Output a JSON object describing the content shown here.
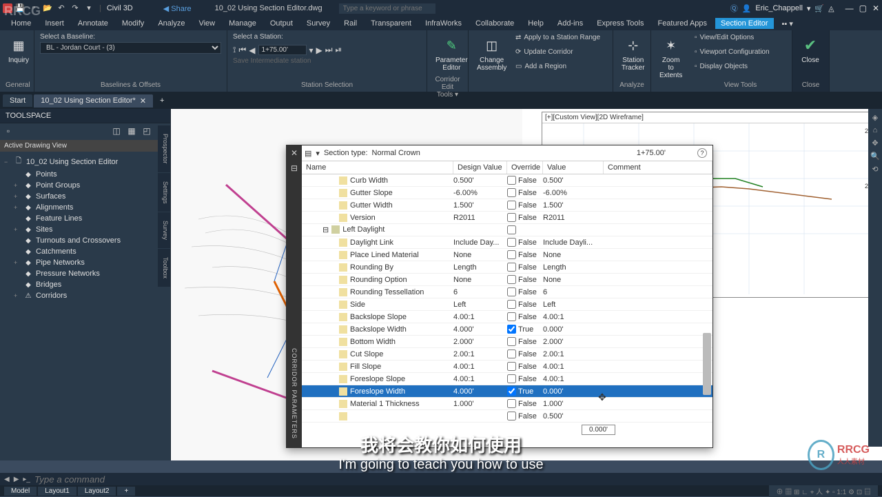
{
  "title": {
    "app": "Civil 3D",
    "share": "◀ Share",
    "filename": "10_02 Using Section Editor.dwg",
    "search_placeholder": "Type a keyword or phrase",
    "user": "Eric_Chappell"
  },
  "menus": [
    "Home",
    "Insert",
    "Annotate",
    "Modify",
    "Analyze",
    "View",
    "Manage",
    "Output",
    "Survey",
    "Rail",
    "Transparent",
    "InfraWorks",
    "Collaborate",
    "Help",
    "Add-ins",
    "Express Tools",
    "Featured Apps",
    "Section Editor"
  ],
  "ribbon": {
    "inquiry": "Inquiry",
    "baseline_label": "Select a Baseline:",
    "baseline_value": "BL - Jordan Court - (3)",
    "station_label": "Select a Station:",
    "station_value": "1+75.00'",
    "save_station": "Save Intermediate station",
    "panels": {
      "general": "General",
      "baselines": "Baselines & Offsets",
      "station": "Station Selection",
      "param_editor": "Parameter Editor",
      "change_asm": "Change Assembly",
      "apply_range": "Apply to a Station Range",
      "update_corr": "Update Corridor",
      "add_region": "Add a Region",
      "cet": "Corridor Edit Tools ▾",
      "st_tracker": "Station Tracker",
      "zoom_ext": "Zoom to Extents",
      "analyze": "Analyze",
      "veo": "View/Edit Options",
      "vpc": "Viewport Configuration",
      "disp": "Display Objects",
      "vt": "View Tools",
      "close": "Close"
    }
  },
  "tabs": {
    "start": "Start",
    "doc": "10_02 Using Section Editor*"
  },
  "toolspace": {
    "title": "TOOLSPACE",
    "adv": "Active Drawing View",
    "root": "10_02 Using Section Editor",
    "nodes": [
      {
        "label": "Points",
        "exp": ""
      },
      {
        "label": "Point Groups",
        "exp": "+"
      },
      {
        "label": "Surfaces",
        "exp": "+"
      },
      {
        "label": "Alignments",
        "exp": "+"
      },
      {
        "label": "Feature Lines",
        "exp": ""
      },
      {
        "label": "Sites",
        "exp": "+"
      },
      {
        "label": "Turnouts and Crossovers",
        "exp": ""
      },
      {
        "label": "Catchments",
        "exp": ""
      },
      {
        "label": "Pipe Networks",
        "exp": "+"
      },
      {
        "label": "Pressure Networks",
        "exp": ""
      },
      {
        "label": "Bridges",
        "exp": ""
      },
      {
        "label": "Corridors",
        "exp": "+",
        "warn": true
      }
    ],
    "vtabs": [
      "Prospector",
      "Settings",
      "Survey",
      "Toolbox"
    ]
  },
  "sectview": "[+][Custom View][2D Wireframe]",
  "panel": {
    "section_type_label": "Section type:",
    "section_type": "Normal Crown",
    "station": "1+75.00'",
    "side_title": "CORRIDOR PARAMETERS",
    "cols": {
      "name": "Name",
      "dv": "Design Value",
      "ov": "Override",
      "val": "Value",
      "cm": "Comment"
    },
    "group": "Left Daylight",
    "rows": [
      {
        "n": "Curb Width",
        "d": "0.500'",
        "o": false,
        "v": "0.500'"
      },
      {
        "n": "Gutter Slope",
        "d": "-6.00%",
        "o": false,
        "v": "-6.00%"
      },
      {
        "n": "Gutter Width",
        "d": "1.500'",
        "o": false,
        "v": "1.500'"
      },
      {
        "n": "Version",
        "d": "R2011",
        "o": false,
        "v": "R2011"
      },
      {
        "group": true,
        "n": "Left Daylight"
      },
      {
        "n": "Daylight Link",
        "d": "Include Day...",
        "o": false,
        "v": "Include Dayli..."
      },
      {
        "n": "Place Lined Material",
        "d": "None",
        "o": false,
        "v": "None"
      },
      {
        "n": "Rounding By",
        "d": "Length",
        "o": false,
        "v": "Length"
      },
      {
        "n": "Rounding Option",
        "d": "None",
        "o": false,
        "v": "None"
      },
      {
        "n": "Rounding Tessellation",
        "d": "6",
        "o": false,
        "v": "6"
      },
      {
        "n": "Side",
        "d": "Left",
        "o": false,
        "v": "Left"
      },
      {
        "n": "Backslope Slope",
        "d": "4.00:1",
        "o": false,
        "v": "4.00:1"
      },
      {
        "n": "Backslope Width",
        "d": "4.000'",
        "o": true,
        "v": "0.000'"
      },
      {
        "n": "Bottom Width",
        "d": "2.000'",
        "o": false,
        "v": "2.000'"
      },
      {
        "n": "Cut Slope",
        "d": "2.00:1",
        "o": false,
        "v": "2.00:1"
      },
      {
        "n": "Fill Slope",
        "d": "4.00:1",
        "o": false,
        "v": "4.00:1"
      },
      {
        "n": "Foreslope Slope",
        "d": "4.00:1",
        "o": false,
        "v": "4.00:1"
      },
      {
        "n": "Foreslope Width",
        "d": "4.000'",
        "o": true,
        "v": "0.000'",
        "sel": true
      },
      {
        "n": "Material 1 Thickness",
        "d": "1.000'",
        "o": false,
        "v": "1.000'"
      },
      {
        "n": "",
        "d": "",
        "o": false,
        "v": "0.500'"
      }
    ],
    "float_val": "0.000'"
  },
  "subtitle": {
    "cn": "我将会教你如何使用",
    "en": "I'm going to teach you how to use"
  },
  "cmd_placeholder": "Type a command",
  "modeltabs": [
    "Model",
    "Layout1",
    "Layout2"
  ],
  "watermark": "RRCG",
  "wm_sub": "人人素材"
}
